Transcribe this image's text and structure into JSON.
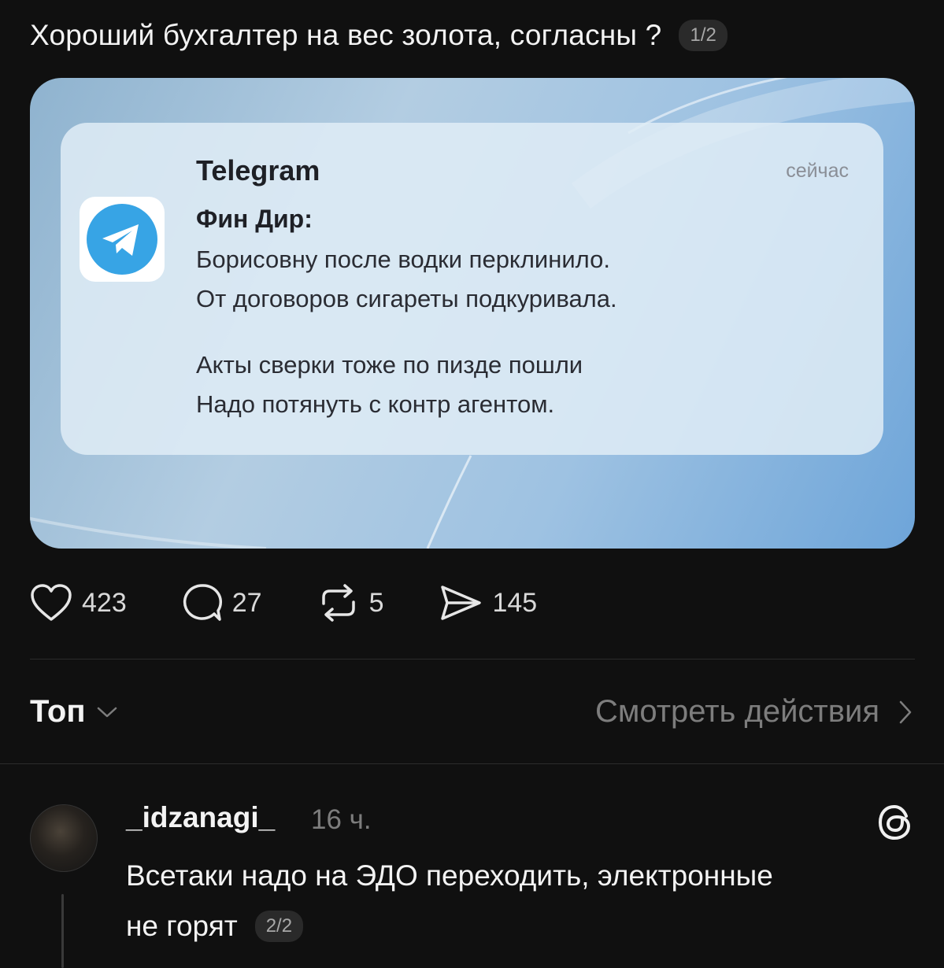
{
  "post": {
    "text": "Хороший бухгалтер на вес золота, согласны ?",
    "counter": "1/2"
  },
  "notification": {
    "app": "Telegram",
    "time": "сейчас",
    "sender": "Фин Дир:",
    "lines": [
      "Борисовну после водки перклинило.",
      "От договоров сигареты подкуривала.",
      "Акты сверки тоже по пизде пошли",
      "Надо потянуть с контр агентом."
    ],
    "icon": "telegram-icon"
  },
  "actions": {
    "likes": "423",
    "comments": "27",
    "reposts": "5",
    "shares": "145"
  },
  "filter": {
    "sort_label": "Топ",
    "view_actions_label": "Смотреть действия"
  },
  "comment": {
    "username": "_idzanagi_",
    "time": "16 ч.",
    "text_line1": "Всетаки надо на ЭДО переходить, электронные",
    "text_line2": "не горят",
    "counter": "2/2"
  },
  "colors": {
    "background": "#101010",
    "telegram_blue": "#37a4e5",
    "muted": "#7d7d7d"
  }
}
